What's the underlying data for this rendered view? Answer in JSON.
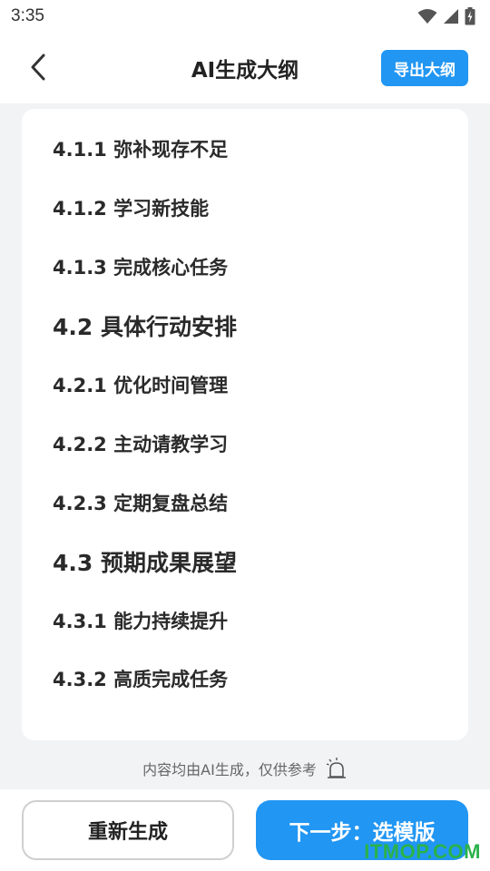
{
  "status_bar": {
    "time": "3:35",
    "icons": [
      "wifi-icon",
      "signal-icon",
      "battery-icon"
    ]
  },
  "header": {
    "back_icon": "chevron-left-icon",
    "title": "AI生成大纲",
    "export_label": "导出大纲"
  },
  "outline": {
    "items": [
      {
        "level": 3,
        "text": "4.1.1 弥补现存不足"
      },
      {
        "level": 3,
        "text": "4.1.2 学习新技能"
      },
      {
        "level": 3,
        "text": "4.1.3 完成核心任务"
      },
      {
        "level": 2,
        "text": "4.2 具体行动安排"
      },
      {
        "level": 3,
        "text": "4.2.1 优化时间管理"
      },
      {
        "level": 3,
        "text": "4.2.2 主动请教学习"
      },
      {
        "level": 3,
        "text": "4.2.3 定期复盘总结"
      },
      {
        "level": 2,
        "text": "4.3 预期成果展望"
      },
      {
        "level": 3,
        "text": "4.3.1 能力持续提升"
      },
      {
        "level": 3,
        "text": "4.3.2 高质完成任务"
      }
    ]
  },
  "footer": {
    "note": "内容均由AI生成，仅供参考",
    "note_icon": "alarm-bell-icon"
  },
  "actions": {
    "regenerate_label": "重新生成",
    "next_label": "下一步：选模版"
  },
  "watermark": "ITMOP.COM",
  "colors": {
    "accent": "#2196f3",
    "background": "#f2f3f5",
    "watermark": "#2ab24a"
  }
}
